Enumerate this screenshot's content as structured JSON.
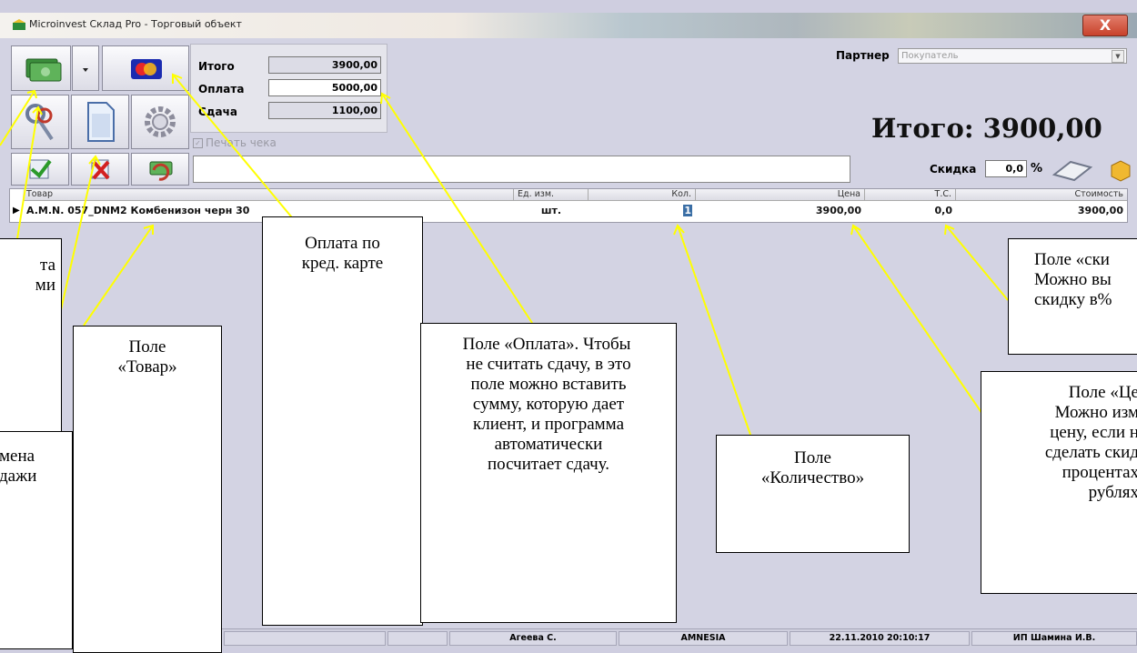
{
  "window": {
    "title": "Microinvest Склад Pro - Торговый объект",
    "close_label": "X"
  },
  "toolbar": {
    "buttons": [
      {
        "name": "cash-payment-button",
        "icon": "money-icon"
      },
      {
        "name": "payment-menu-button",
        "icon": "dropdown-arrow-icon"
      },
      {
        "name": "card-payment-button",
        "icon": "credit-card-icon"
      },
      {
        "name": "keys-button",
        "icon": "keys-icon"
      },
      {
        "name": "document-button",
        "icon": "document-icon"
      },
      {
        "name": "settings-button",
        "icon": "gear-icon"
      },
      {
        "name": "confirm-button",
        "icon": "check-icon"
      },
      {
        "name": "cancel-sale-button",
        "icon": "cancel-icon"
      },
      {
        "name": "return-button",
        "icon": "money-return-icon"
      }
    ]
  },
  "totals": {
    "total_label": "Итого",
    "total_value": "3900,00",
    "payment_label": "Оплата",
    "payment_value": "5000,00",
    "change_label": "Сдача",
    "change_value": "1100,00"
  },
  "print_check": {
    "label": "Печать чека",
    "checked": true
  },
  "partner": {
    "label": "Партнер",
    "value": "Покупатель"
  },
  "big_total": "Итого: 3900,00",
  "discount": {
    "label": "Скидка",
    "value": "0,0",
    "unit": "%"
  },
  "grid": {
    "headers": {
      "product": "Товар",
      "unit": "Ед. изм.",
      "qty": "Кол.",
      "price": "Цена",
      "ts": "Т.С.",
      "cost": "Стоимость"
    },
    "rows": [
      {
        "product": "A.M.N. 057_DNM2 Комбенизон черн 30",
        "unit": "шт.",
        "qty": "1",
        "price": "3900,00",
        "ts": "0,0",
        "cost": "3900,00"
      }
    ]
  },
  "status": {
    "user": "Агеева С.",
    "object": "AMNESIA",
    "datetime": "22.11.2010 20:10:17",
    "company": "ИП Шамина И.В."
  },
  "callouts": {
    "c1": "та\nми",
    "c2": "мена\nдажи",
    "c3": "Поле\n«Товар»",
    "c4": "Оплата по\nкред. карте",
    "c5": "Поле «Оплата». Чтобы\nне считать сдачу, в это\nполе можно вставить\nсумму, которую дает\nклиент, и программа\nавтоматически\nпосчитает сдачу.",
    "c6": "Поле\n«Количество»",
    "c7": "Поле «ски\nМожно вы\nскидку в%",
    "c8": "Поле «Це\nМожно изм\nцену, если н\nсделать скид\nпроцентах\nрублях"
  }
}
